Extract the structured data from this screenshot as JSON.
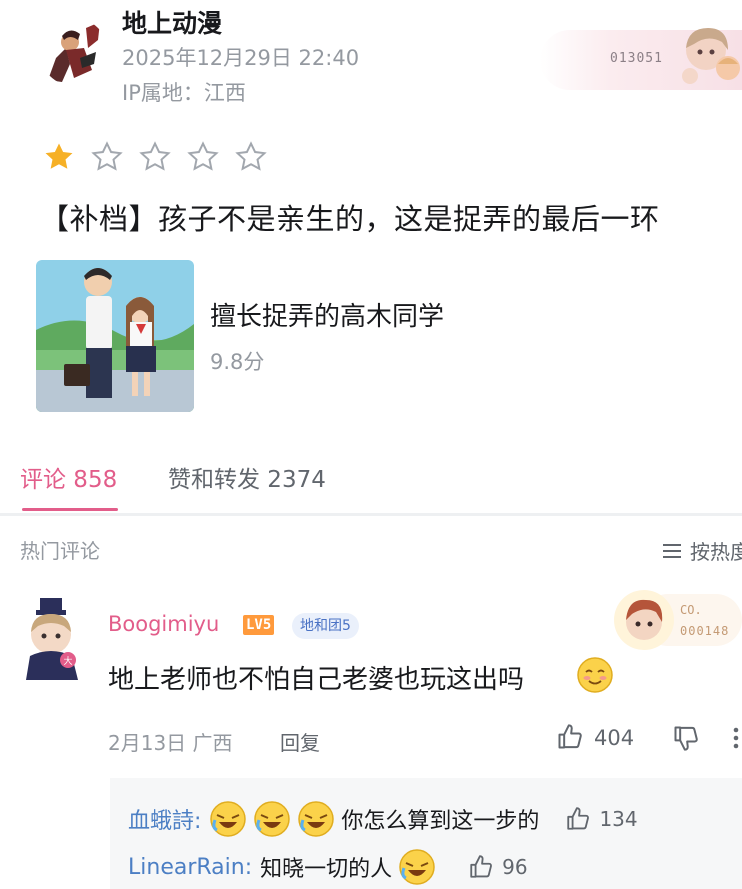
{
  "post": {
    "author": "地上动漫",
    "time": "2025年12月29日 22:40",
    "ip": "IP属地：江西",
    "fan_number": "013051",
    "rating": {
      "stars_filled": 1,
      "stars_total": 5
    },
    "text": "【补档】孩子不是亲生的，这是捉弄的最后一环"
  },
  "card": {
    "title": "擅长捉弄的高木同学",
    "score": "9.8分"
  },
  "tabs": {
    "comments": "评论 858",
    "reposts": "赞和转发 2374"
  },
  "section": {
    "hot_label": "热门评论",
    "sort_label": "按热度"
  },
  "comment": {
    "username": "Boogimiyu",
    "level": "LV5",
    "fan_medal": "地和团5",
    "deco_text1": "CO.",
    "deco_text2": "000148",
    "text": "地上老师也不怕自己老婆也玩这出吗",
    "date_location": "2月13日 广西",
    "reply_label": "回复",
    "likes": "404"
  },
  "replies": [
    {
      "user": "血蛾詩:",
      "text": "你怎么算到这一步的",
      "likes": "134",
      "emoji_count": 3
    },
    {
      "user": "LinearRain:",
      "text": "知晓一切的人",
      "likes": "96",
      "emoji_count": 1
    }
  ],
  "colors": {
    "accent_pink": "#e25d8a",
    "star_gold": "#f6b026",
    "link_blue": "#4c7fc4",
    "level_orange": "#ff9a3c"
  }
}
